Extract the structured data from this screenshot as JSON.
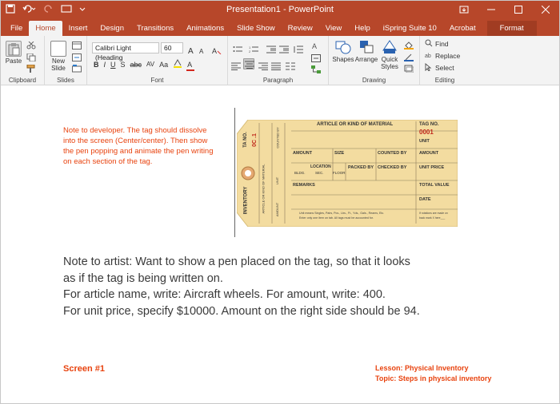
{
  "window": {
    "title": "Presentation1 - PowerPoint",
    "controls": [
      "ribbon-display-icon",
      "minimize-icon",
      "maximize-icon",
      "close-icon"
    ]
  },
  "qat": [
    "save-icon",
    "undo-icon",
    "redo-icon",
    "slideshow-from-start-icon",
    "customize-qat-icon"
  ],
  "tabs": [
    {
      "label": "File"
    },
    {
      "label": "Home"
    },
    {
      "label": "Insert"
    },
    {
      "label": "Design"
    },
    {
      "label": "Transitions"
    },
    {
      "label": "Animations"
    },
    {
      "label": "Slide Show"
    },
    {
      "label": "Review"
    },
    {
      "label": "View"
    },
    {
      "label": "Help"
    },
    {
      "label": "iSpring Suite 10"
    },
    {
      "label": "Acrobat"
    },
    {
      "label": "Format"
    }
  ],
  "active_tab": "Home",
  "ribbon": {
    "clipboard": {
      "label": "Clipboard",
      "paste": "Paste"
    },
    "slides": {
      "label": "Slides",
      "new_slide": "New",
      "new_slide2": "Slide"
    },
    "font": {
      "label": "Font",
      "font_name": "Calibri Light (Heading",
      "font_size": "60",
      "bold": "B",
      "italic": "I",
      "underline": "U",
      "shadow": "S",
      "strike": "abc",
      "spacing": "AV",
      "case": "Aa",
      "color": "A"
    },
    "paragraph": {
      "label": "Paragraph"
    },
    "drawing": {
      "label": "Drawing",
      "shapes": "Shapes",
      "arrange": "Arrange",
      "quick1": "Quick",
      "quick2": "Styles"
    },
    "editing": {
      "label": "Editing",
      "find": "Find",
      "replace": "Replace",
      "select": "Select"
    }
  },
  "slide": {
    "note_dev": "Note to developer. The tag should dissolve into the screen (Center/center). Then show the pen popping and animate the pen writing on each section of the tag.",
    "note_artist": [
      "Note to artist: Want to show a pen placed on the tag, so that it looks",
      "as if the tag is being written on.",
      "For article name, write: Aircraft wheels. For amount, write: 400.",
      "For unit price, specify $10000. Amount on the right side should be 94."
    ],
    "screen": "Screen #1",
    "lesson": "Lesson: Physical Inventory",
    "topic": "Topic: Steps in physical inventory"
  },
  "tag": {
    "header": "ARTICLE OR KIND OF MATERIAL",
    "tag_no_label": "TAG NO.",
    "tag_no": "0001",
    "unit": "UNIT",
    "amount": "AMOUNT",
    "size": "SIZE",
    "counted_by": "COUNTED BY",
    "amount2": "AMOUNT",
    "location": "LOCATION",
    "bldg": "BLDG.",
    "sec": "SEC.",
    "floor": "FLOOR",
    "packed_by": "PACKED BY",
    "checked_by": "CHECKED BY",
    "unit_price": "UNIT PRICE",
    "remarks": "REMARKS",
    "total_value": "TOTAL VALUE",
    "date": "DATE",
    "stub_tag_no": "TA  NO.",
    "stub_no": "0C .1",
    "stub_inventory": "INVENTORY",
    "stub_article": "ARTICLE OR KIND OF MATERIAL",
    "stub_counted": "COUNTED BY",
    "stub_unit": "UNIT",
    "stub_amount": "AMOUNT",
    "footer1": "Unit means Singles, Pairs, Pcs., Lbs., Ft., Yds., Gals., Reams, Etc.",
    "footer2": "Enter only one item on tab. All tags must be accounted for.",
    "footer_right1": "If rotations are made on",
    "footer_right2": "back mark X here___",
    "colors": {
      "paper": "#f3dca0",
      "line": "#8a7a5a",
      "red": "#c0281c"
    }
  }
}
